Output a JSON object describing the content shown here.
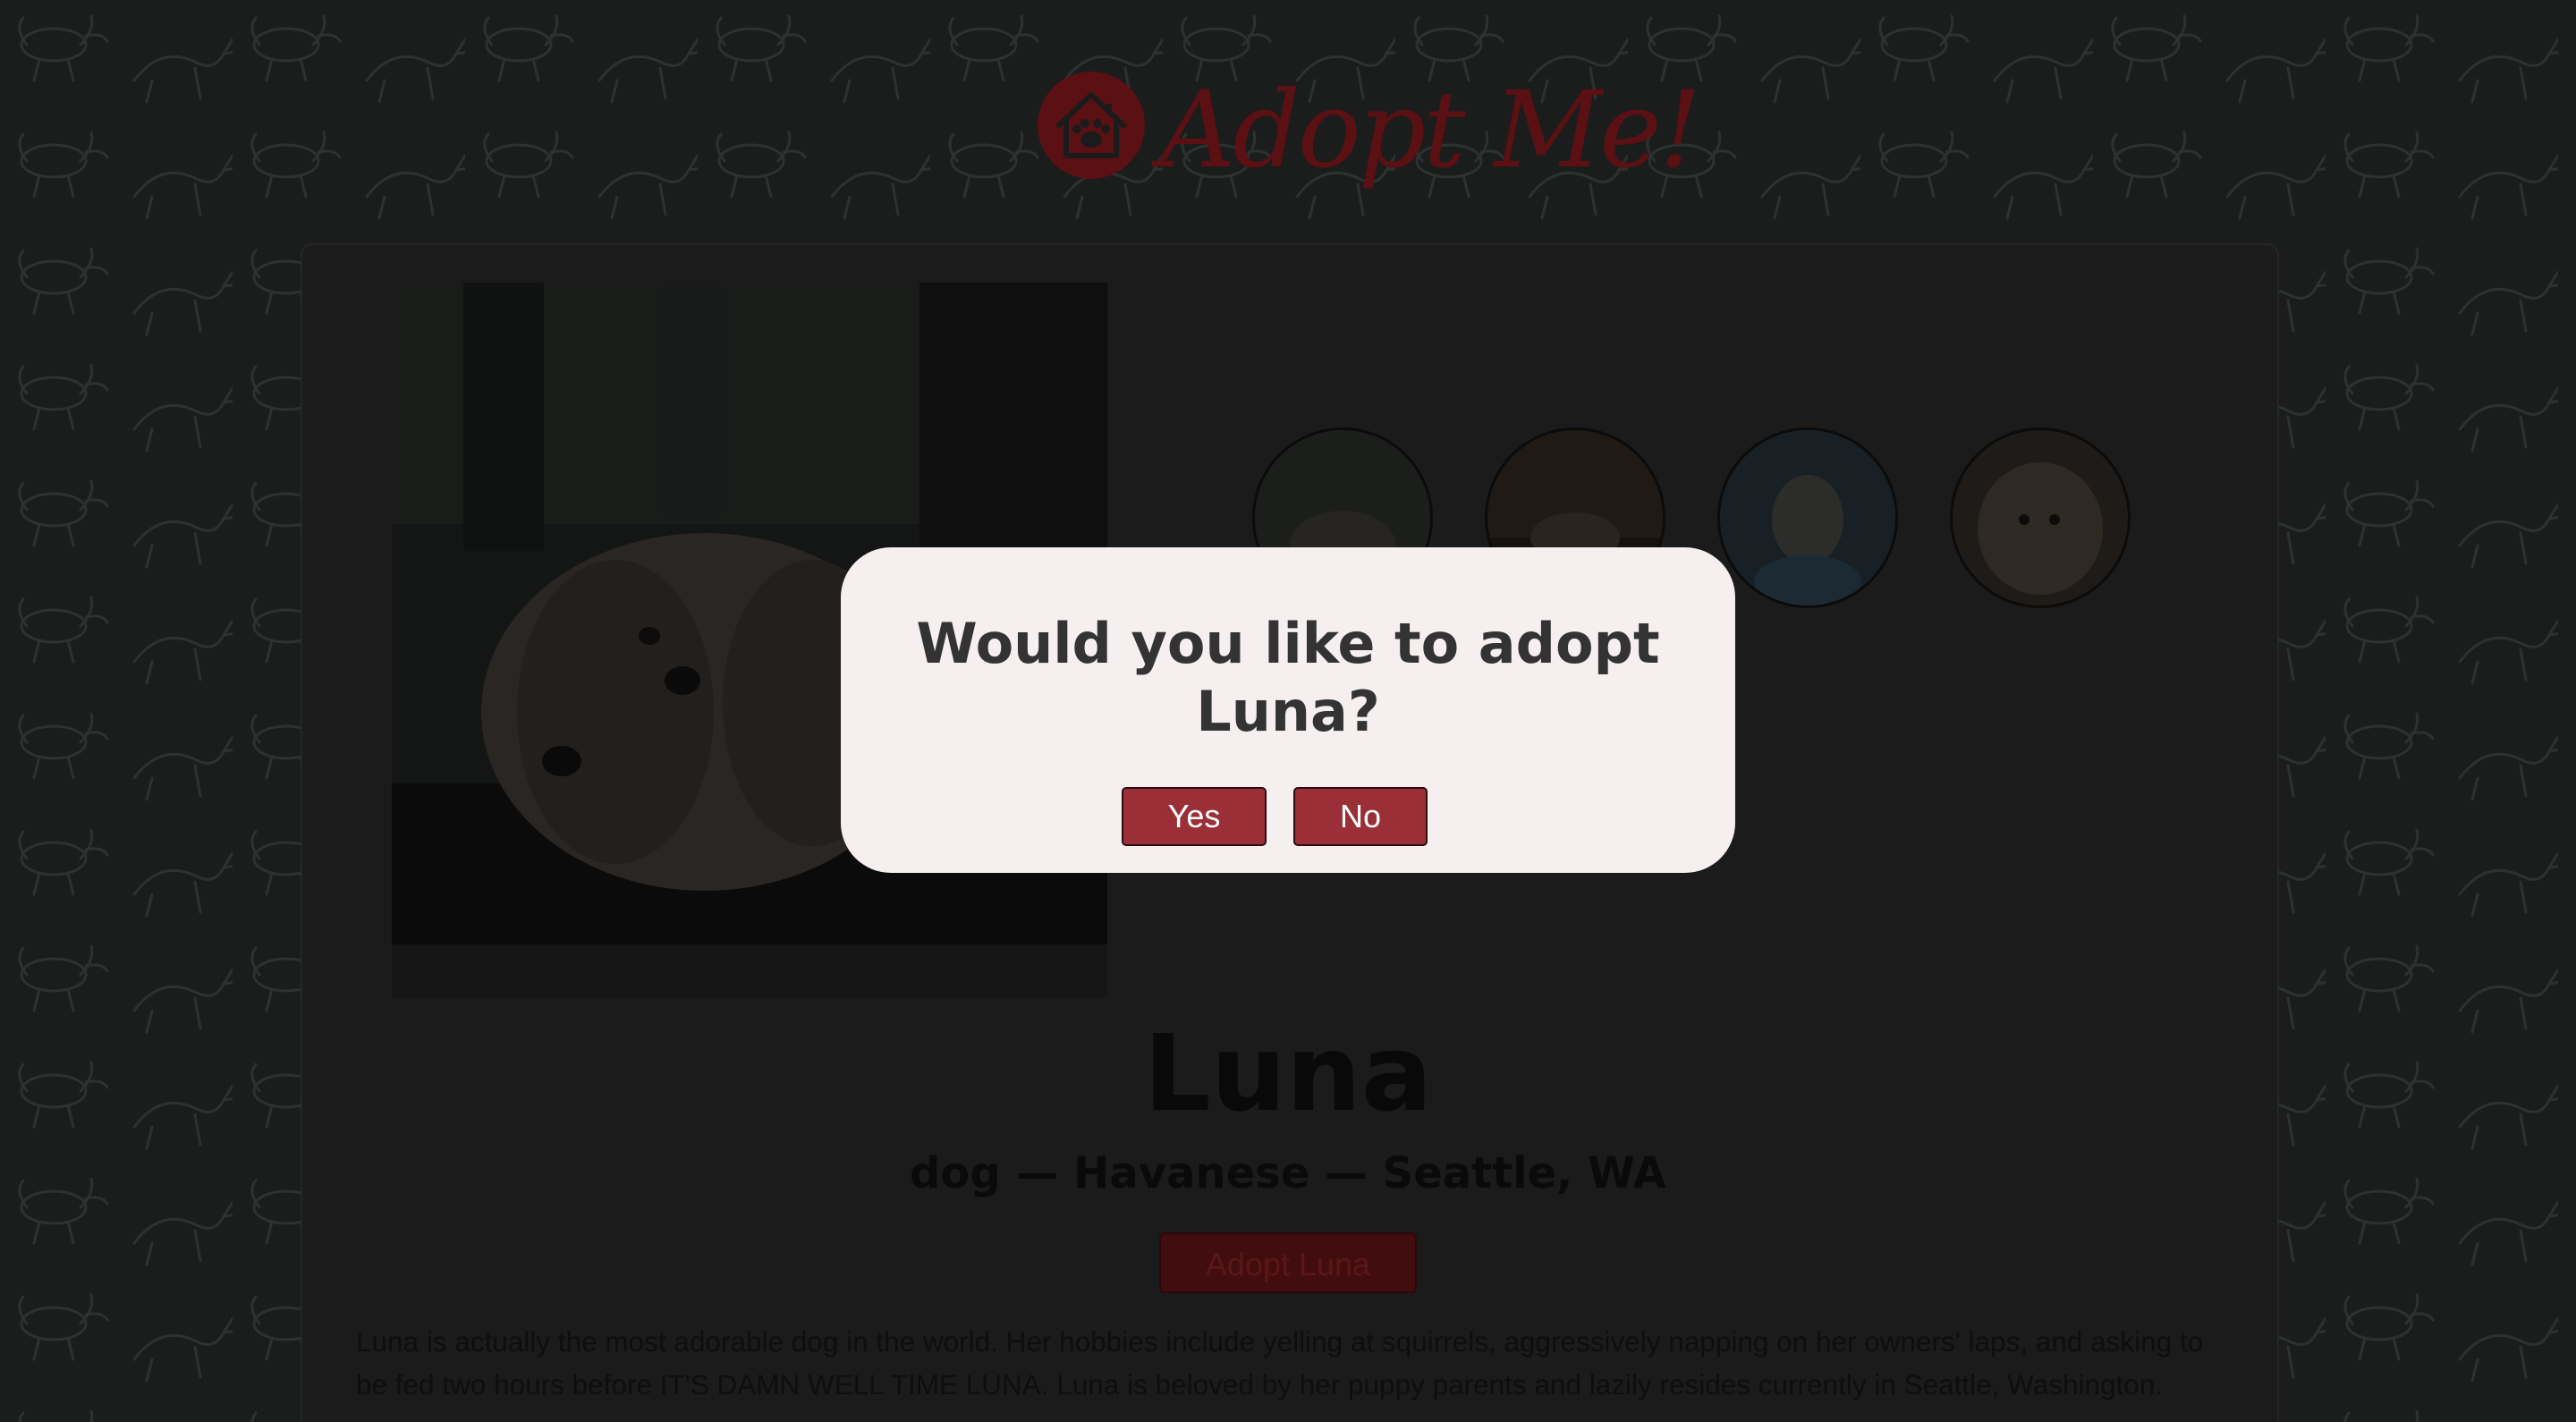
{
  "header": {
    "logo_text": "Adopt Me!",
    "logo_icon": "house-paw-icon"
  },
  "pet": {
    "name": "Luna",
    "meta": "dog — Havanese — Seattle, WA",
    "adopt_button_label": "Adopt Luna",
    "description": "Luna is actually the most adorable dog in the world. Her hobbies include yelling at squirrels, aggressively napping on her owners' laps, and asking to be fed two hours before IT'S DAMN WELL TIME LUNA. Luna is beloved by her puppy parents and lazily resides currently in Seattle, Washington."
  },
  "modal": {
    "title_line1": "Would you like to adopt",
    "title_line2": "Luna?",
    "yes_label": "Yes",
    "no_label": "No"
  },
  "colors": {
    "brand_red": "#9b2f38",
    "modal_bg": "#f6efef",
    "overlay_dim": "#1a1b1b"
  }
}
